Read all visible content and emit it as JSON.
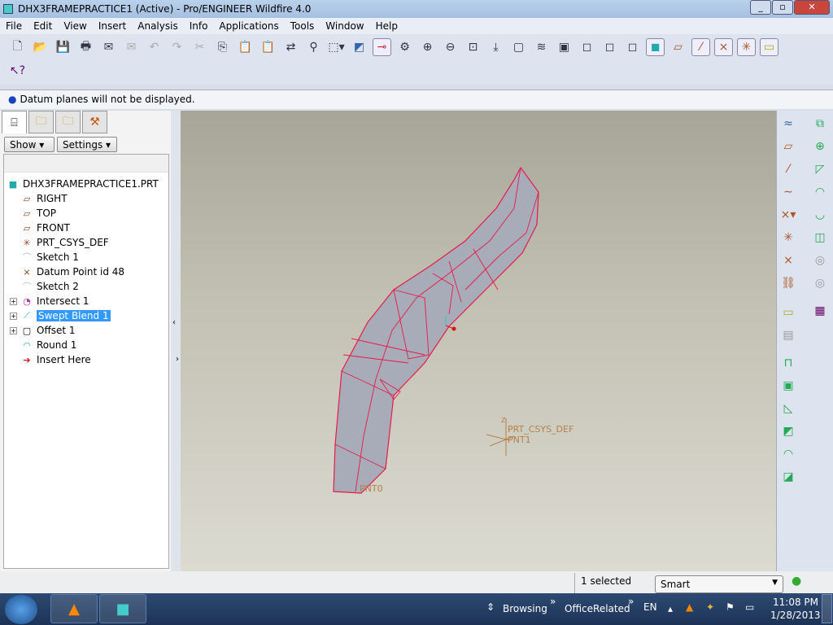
{
  "window": {
    "title": "DHX3FRAMEPRACTICE1 (Active) - Pro/ENGINEER Wildfire 4.0"
  },
  "menu": [
    "File",
    "Edit",
    "View",
    "Insert",
    "Analysis",
    "Info",
    "Applications",
    "Tools",
    "Window",
    "Help"
  ],
  "message": "Datum planes will not be displayed.",
  "panel": {
    "show_label": "Show",
    "settings_label": "Settings"
  },
  "tree": {
    "root": "DHX3FRAMEPRACTICE1.PRT",
    "items": [
      {
        "label": "RIGHT",
        "icon": "datum-plane-icon"
      },
      {
        "label": "TOP",
        "icon": "datum-plane-icon"
      },
      {
        "label": "FRONT",
        "icon": "datum-plane-icon"
      },
      {
        "label": "PRT_CSYS_DEF",
        "icon": "csys-icon"
      },
      {
        "label": "Sketch 1",
        "icon": "sketch-icon"
      },
      {
        "label": "Datum Point id 48",
        "icon": "datum-point-icon"
      },
      {
        "label": "Sketch 2",
        "icon": "sketch-icon"
      },
      {
        "label": "Intersect 1",
        "icon": "intersect-icon",
        "expandable": true
      },
      {
        "label": "Swept Blend 1",
        "icon": "swept-blend-icon",
        "expandable": true,
        "selected": true
      },
      {
        "label": "Offset 1",
        "icon": "offset-icon",
        "expandable": true
      },
      {
        "label": "Round 1",
        "icon": "round-icon"
      },
      {
        "label": "Insert Here",
        "icon": "insert-arrow-icon"
      }
    ]
  },
  "viewport": {
    "labels": {
      "csys": "PRT_CSYS_DEF",
      "pnt1": "PNT1",
      "pnt0": "PNT0",
      "z": "Z"
    },
    "highlight_color": "#e8194a",
    "model_color": "#a8acb8"
  },
  "status": {
    "selected": "1 selected",
    "filter": "Smart"
  },
  "taskbar": {
    "toolbar1": "Browsing",
    "toolbar2": "OfficeRelated",
    "lang": "EN",
    "time": "11:08 PM",
    "date": "1/28/2013"
  }
}
